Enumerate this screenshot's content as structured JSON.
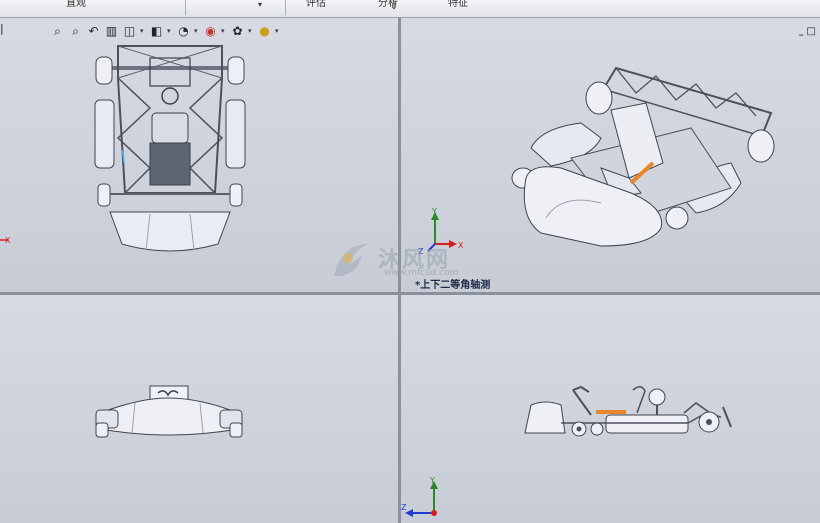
{
  "top_toolbar": {
    "tabs": [
      "直观",
      "评估",
      "分析",
      "特征"
    ]
  },
  "view_toolbar": {
    "icons": [
      "zoom-to-fit-icon",
      "zoom-area-icon",
      "previous-view-icon",
      "section-view-icon",
      "view-orientation-icon",
      "display-style-icon",
      "hide-show-icon",
      "edit-appearance-icon",
      "apply-scene-icon",
      "view-settings-icon"
    ]
  },
  "viewport_controls": {
    "collapse": "–",
    "restore": "□"
  },
  "viewports": {
    "top_left": {
      "name": "top-view"
    },
    "top_right": {
      "name": "isometric-view",
      "label": "*上下二等角轴测"
    },
    "bottom_left": {
      "name": "front-view"
    },
    "bottom_right": {
      "name": "side-view"
    }
  },
  "triad": {
    "x": "X",
    "y": "Y",
    "z": "Z"
  },
  "watermark": {
    "text": "沐风网",
    "url": "www.mfcad.com"
  },
  "colors": {
    "background": "#c9cdd6",
    "frame_metal": "#5a606c",
    "body_panel": "#e8ebf2",
    "accent_orange": "#e8862c",
    "triad_x": "#d21f1f",
    "triad_y": "#2a8a2a",
    "triad_z": "#1f3fd2"
  }
}
